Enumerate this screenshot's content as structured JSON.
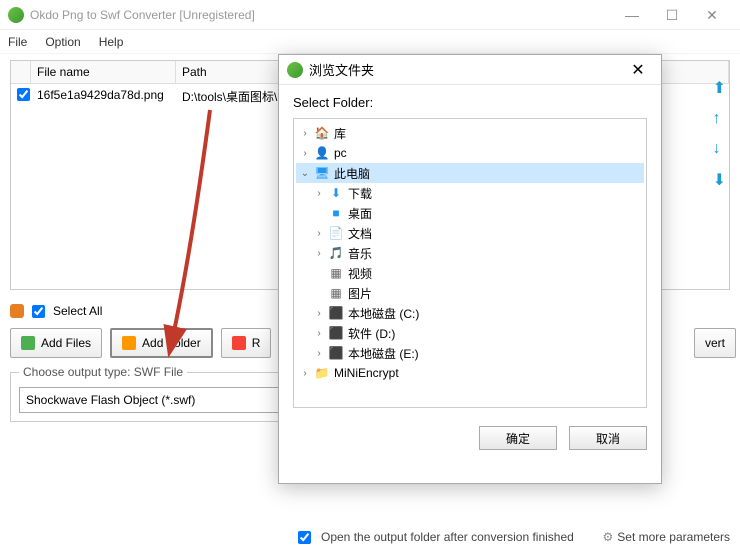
{
  "window": {
    "title": "Okdo Png to Swf Converter [Unregistered]"
  },
  "menu": {
    "file": "File",
    "option": "Option",
    "help": "Help"
  },
  "columns": {
    "filename": "File name",
    "path": "Path"
  },
  "rows": [
    {
      "name": "16f5e1a9429da78d.png",
      "path": "D:\\tools\\桌面图标\\i"
    }
  ],
  "selectall": "Select All",
  "buttons": {
    "add_files": "Add Files",
    "add_folder": "Add Folder",
    "remove_partial": "R",
    "convert_partial": "vert"
  },
  "output": {
    "legend": "Choose output type:  SWF File",
    "value": "Shockwave Flash Object (*.swf)"
  },
  "open_after": "Open the output folder after conversion finished",
  "set_more": "Set more parameters",
  "dialog": {
    "title": "浏览文件夹",
    "select_label": "Select Folder:",
    "ok": "确定",
    "cancel": "取消",
    "tree": [
      {
        "indent": 0,
        "expander": "›",
        "icon": "🏠",
        "color": "#4caf50",
        "label": "库",
        "selected": false
      },
      {
        "indent": 0,
        "expander": "›",
        "icon": "👤",
        "color": "#888",
        "label": "pc",
        "selected": false
      },
      {
        "indent": 0,
        "expander": "⌄",
        "icon": "🖥",
        "color": "#2196f3",
        "label": "此电脑",
        "selected": true
      },
      {
        "indent": 1,
        "expander": "›",
        "icon": "⬇",
        "color": "#2196f3",
        "label": "下载",
        "selected": false
      },
      {
        "indent": 1,
        "expander": "",
        "icon": "■",
        "color": "#2196f3",
        "label": "桌面",
        "selected": false
      },
      {
        "indent": 1,
        "expander": "›",
        "icon": "📄",
        "color": "#888",
        "label": "文档",
        "selected": false
      },
      {
        "indent": 1,
        "expander": "›",
        "icon": "🎵",
        "color": "#4caf50",
        "label": "音乐",
        "selected": false
      },
      {
        "indent": 1,
        "expander": "",
        "icon": "▦",
        "color": "#666",
        "label": "视频",
        "selected": false
      },
      {
        "indent": 1,
        "expander": "",
        "icon": "▦",
        "color": "#666",
        "label": "图片",
        "selected": false
      },
      {
        "indent": 1,
        "expander": "›",
        "icon": "⬛",
        "color": "#444",
        "label": "本地磁盘 (C:)",
        "selected": false
      },
      {
        "indent": 1,
        "expander": "›",
        "icon": "⬛",
        "color": "#444",
        "label": "软件 (D:)",
        "selected": false
      },
      {
        "indent": 1,
        "expander": "›",
        "icon": "⬛",
        "color": "#444",
        "label": "本地磁盘 (E:)",
        "selected": false
      },
      {
        "indent": 0,
        "expander": "›",
        "icon": "📁",
        "color": "#f6c142",
        "label": "MiNiEncrypt",
        "selected": false
      }
    ]
  }
}
